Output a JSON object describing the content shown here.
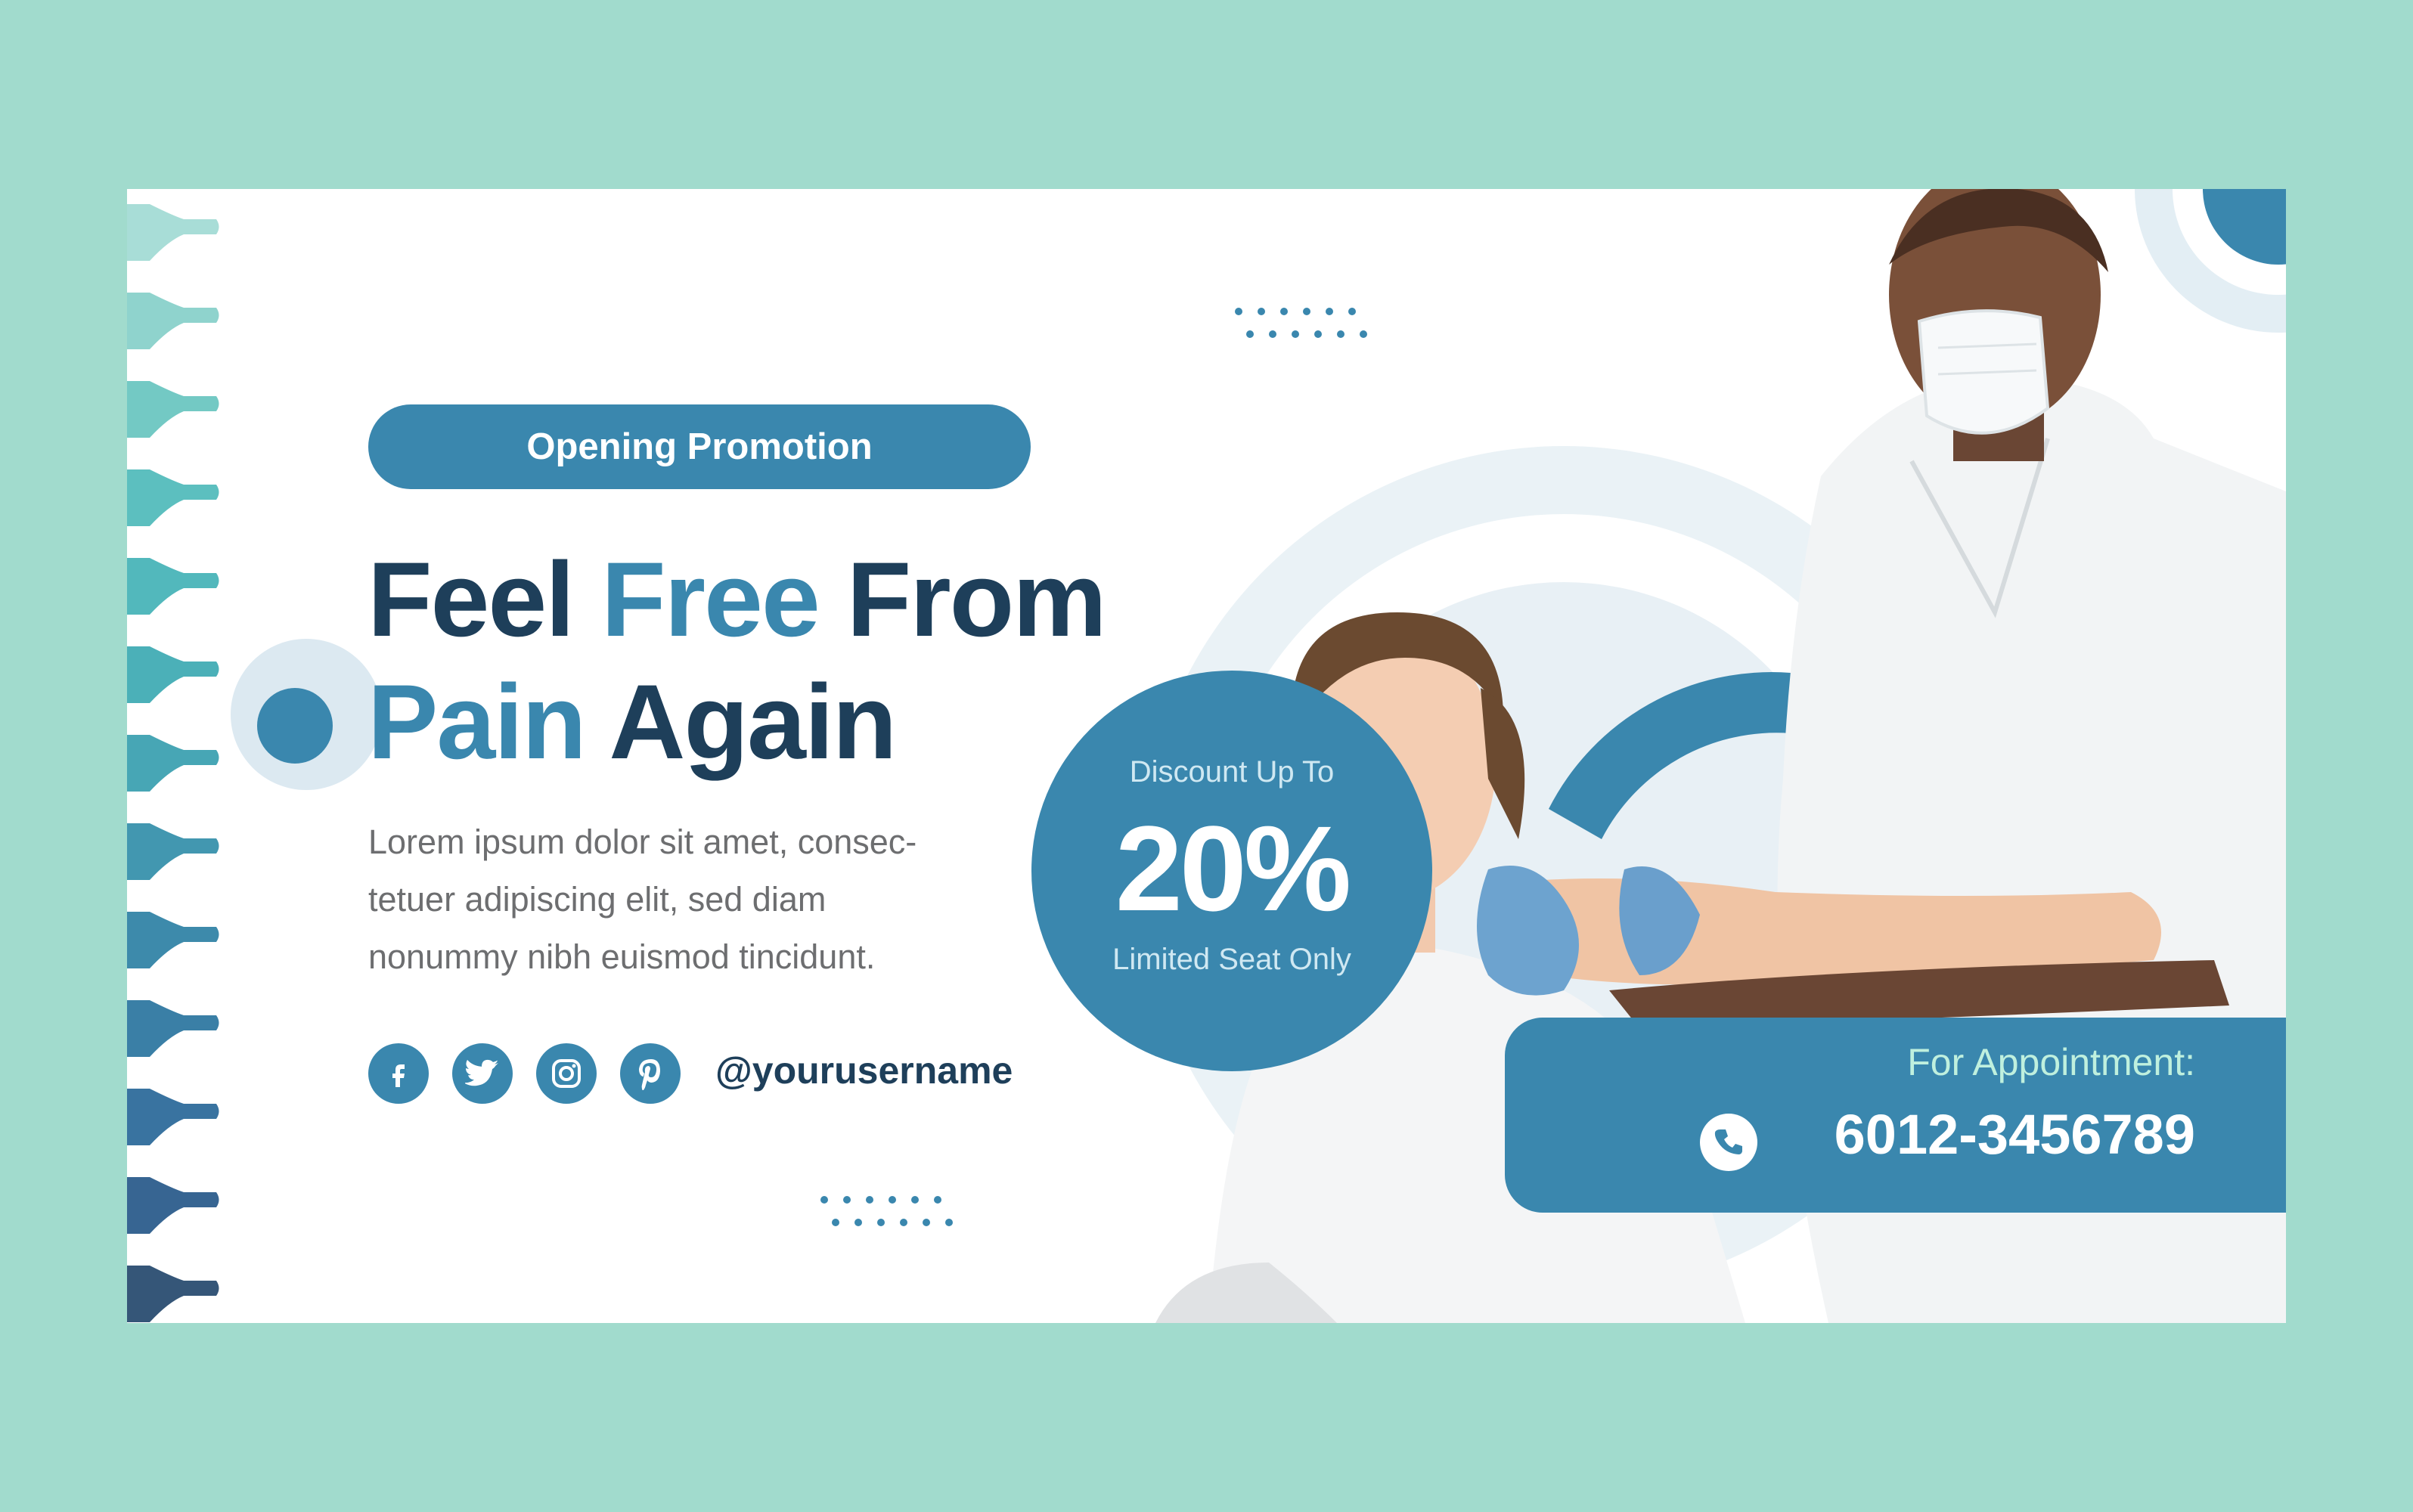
{
  "promo": {
    "badge": "Opening Promotion",
    "headline": {
      "line1_a": "Feel ",
      "line1_b": "Free",
      "line1_c": " From",
      "line2_a": "Pain",
      "line2_b": " Again"
    },
    "body_line1": "Lorem ipsum dolor sit amet, consec-",
    "body_line2": "tetuer adipiscing elit, sed diam",
    "body_line3": "nonummy nibh euismod tincidunt.",
    "social": {
      "icons": [
        "facebook-icon",
        "twitter-icon",
        "instagram-icon",
        "pinterest-icon"
      ],
      "handle": "@yourusername"
    }
  },
  "discount": {
    "label": "Discount Up To",
    "value": "20%",
    "note": "Limited Seat Only"
  },
  "appointment": {
    "label": "For Appointment:",
    "phone": "6012-3456789",
    "icon": "phone-icon"
  },
  "colors": {
    "background": "#a1dbcd",
    "primary": "#3a87ae",
    "dark_text": "#1e3f5a",
    "body_text": "#6d6e70",
    "teal": "#4fbcbf"
  }
}
